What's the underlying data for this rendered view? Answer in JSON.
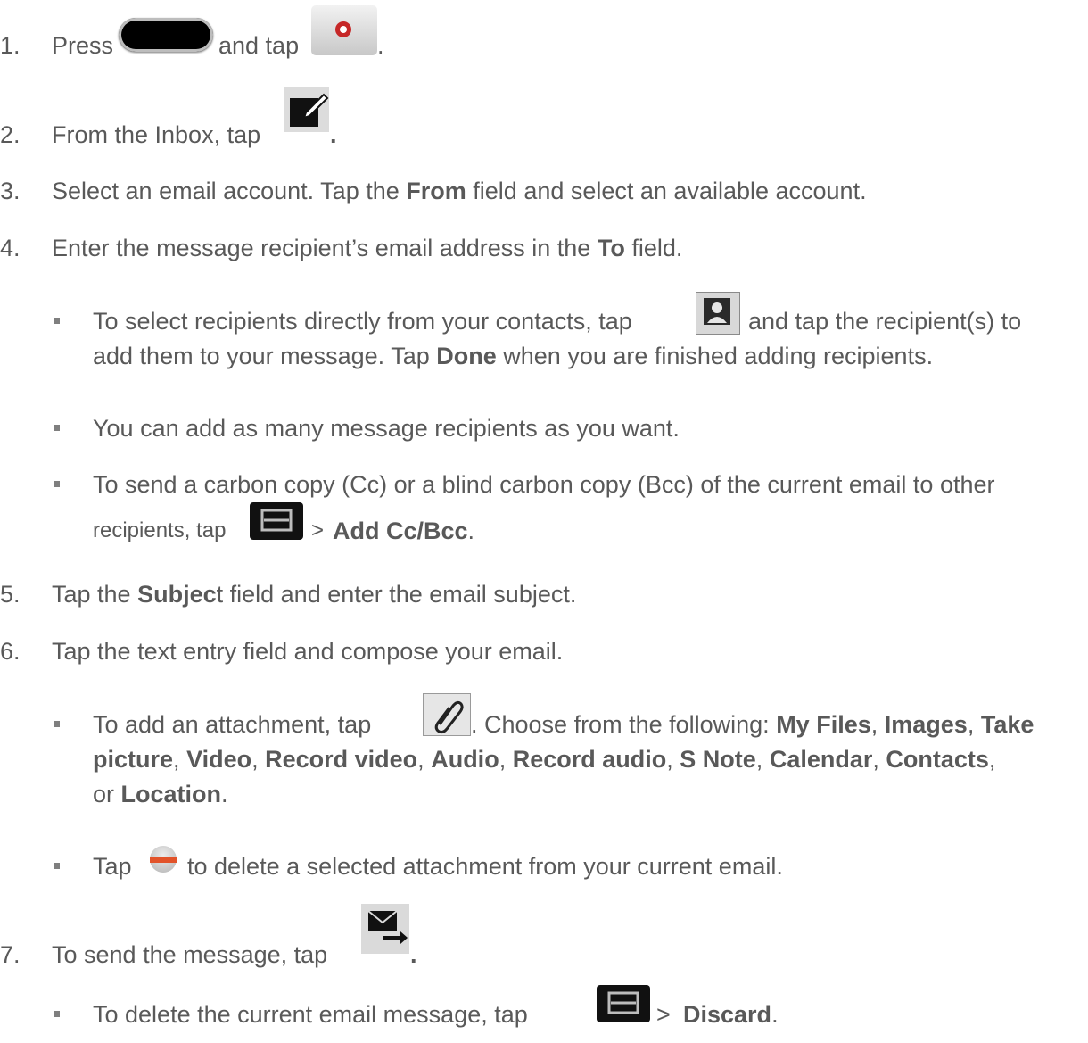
{
  "steps": [
    {
      "num": "1.",
      "t1": "Press",
      "t2": "and tap",
      "t3": "."
    },
    {
      "num": "2.",
      "t1": "From the Inbox, tap",
      "t2": "."
    },
    {
      "num": "3.",
      "t1": "Select an email account. Tap the",
      "b1": "From",
      "t2": "field and select an available account."
    },
    {
      "num": "4.",
      "t1": "Enter the message recipient’s email address in the",
      "b1": "To",
      "t2": "field."
    },
    {
      "num": "5.",
      "t1": "Tap the",
      "b1": "Subjec",
      "t2": "t field and enter the email subject."
    },
    {
      "num": "6.",
      "t1": "Tap the text entry field and compose your email."
    },
    {
      "num": "7.",
      "t1": "To send the message, tap",
      "t2": "."
    }
  ],
  "bullets": {
    "contacts": {
      "l1a": "To select recipients directly from your contacts, tap",
      "l1b": "and tap the recipient(s) to",
      "l2a": "add them to your message. Tap",
      "l2b": "Done",
      "l2c": "when you are finished adding recipients."
    },
    "many": {
      "text": "You can add as many message recipients as you want."
    },
    "cc": {
      "l1": "To send a carbon copy (Cc) or a blind carbon copy (Bcc) of the current email to other",
      "l2a": "recipients, tap",
      "sep": ">",
      "l2b": "Add Cc/Bcc",
      "l2c": "."
    },
    "attach": {
      "l1a": "To add an attachment, tap",
      "l1b": ". Choose from the following:",
      "my_files": "My Files",
      "images": "Images",
      "take": "Take",
      "picture": "picture",
      "video": "Video",
      "record_video": "Record video",
      "audio": "Audio",
      "record_audio": "Record audio",
      "s_note": "S Note",
      "calendar": "Calendar",
      "contacts": "Contacts",
      "or": "or",
      "location": "Location",
      "comma": ",",
      "period": "."
    },
    "delete_attach": {
      "l1a": "Tap",
      "l1b": "to delete a selected attachment from your current email."
    },
    "discard": {
      "l1a": "To delete the current email message, tap",
      "sep": ">",
      "l1b": "Discard",
      "l1c": "."
    }
  },
  "icons": [
    "home-key-icon",
    "email-app-icon",
    "compose-icon",
    "contacts-icon",
    "menu-key-icon",
    "paperclip-icon",
    "remove-attachment-icon",
    "send-email-icon"
  ],
  "colors": {
    "text": "#595959",
    "remove_red": "#e2532a",
    "email_red": "#c62828"
  }
}
